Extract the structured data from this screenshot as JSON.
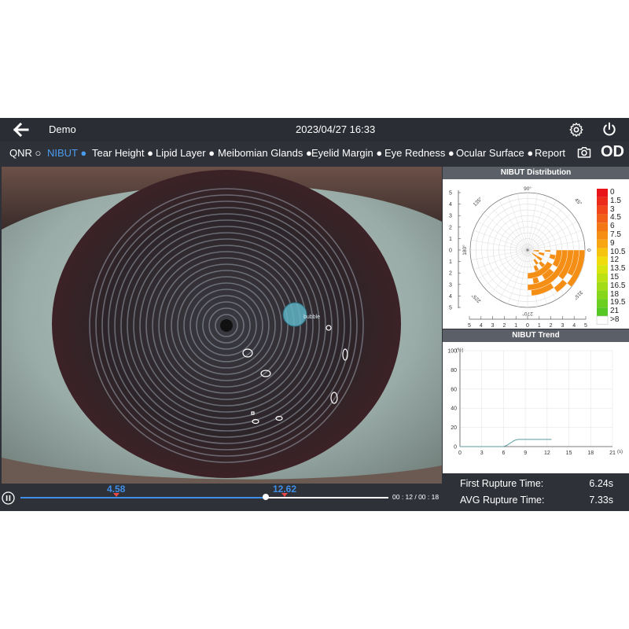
{
  "header": {
    "title": "Demo",
    "datetime": "2023/04/27 16:33"
  },
  "tabs": [
    {
      "label": "QNR ○"
    },
    {
      "label": "NIBUT ●"
    },
    {
      "label": "Tear Height ●"
    },
    {
      "label": "Lipid Layer ●"
    },
    {
      "label": "Meibomian Glands ●"
    },
    {
      "label": "Eyelid Margin ●"
    },
    {
      "label": "Eye Redness ●"
    },
    {
      "label": "Ocular Surface ●"
    },
    {
      "label": "Report"
    }
  ],
  "active_tab": "NIBUT ●",
  "eye_label": "OD",
  "eye_overlay_text": "bubble",
  "playback": {
    "markers": [
      "4.58",
      "12.62"
    ],
    "progress": 0.667,
    "timecode": "00 : 12 / 00 : 18"
  },
  "distribution": {
    "title": "NIBUT Distribution",
    "angle_labels": [
      "90°",
      "45°",
      "0",
      "315°",
      "270°",
      "225°",
      "180°",
      "135°"
    ],
    "axis_ticks": [
      "5",
      "4",
      "3",
      "2",
      "1",
      "0",
      "1",
      "2",
      "3",
      "4",
      "5"
    ],
    "legend": [
      {
        "label": "0",
        "color": "#e8141a"
      },
      {
        "label": "1.5",
        "color": "#ec2a1a"
      },
      {
        "label": "3",
        "color": "#f0461a"
      },
      {
        "label": "4.5",
        "color": "#f25f18"
      },
      {
        "label": "6",
        "color": "#f47716"
      },
      {
        "label": "7.5",
        "color": "#f58e14"
      },
      {
        "label": "9",
        "color": "#f7a512"
      },
      {
        "label": "10.5",
        "color": "#f6c30f"
      },
      {
        "label": "12",
        "color": "#f0dc0c"
      },
      {
        "label": "13.5",
        "color": "#d8e40e"
      },
      {
        "label": "15",
        "color": "#bce214"
      },
      {
        "label": "16.5",
        "color": "#a2dc18"
      },
      {
        "label": "18",
        "color": "#86d61c"
      },
      {
        "label": "19.5",
        "color": "#6ccf20"
      },
      {
        "label": "21",
        "color": "#55c824"
      },
      {
        "label": ">8",
        "color": "#ffffff"
      }
    ]
  },
  "trend": {
    "title": "NIBUT Trend",
    "y_unit": "(%)",
    "x_unit": "(s)",
    "y_ticks": [
      "100",
      "80",
      "60",
      "40",
      "20",
      "0"
    ],
    "x_ticks": [
      "0",
      "3",
      "6",
      "9",
      "12",
      "15",
      "18",
      "21"
    ]
  },
  "chart_data": {
    "type": "line",
    "title": "NIBUT Trend",
    "xlabel": "(s)",
    "ylabel": "(%)",
    "xlim": [
      0,
      21
    ],
    "ylim": [
      0,
      100
    ],
    "x": [
      0,
      6,
      6.2,
      6.5,
      6.8,
      7.1,
      7.4,
      7.7,
      8,
      8.3,
      9,
      10,
      11,
      12,
      12.6
    ],
    "y": [
      0,
      0,
      0.5,
      1.5,
      3,
      4.5,
      6,
      7,
      7.5,
      7.5,
      7.5,
      7.5,
      7.5,
      7.5,
      7.5
    ]
  },
  "stats": [
    {
      "label": "First Rupture Time:",
      "value": "6.24s"
    },
    {
      "label": "AVG Rupture Time:",
      "value": "7.33s"
    }
  ]
}
